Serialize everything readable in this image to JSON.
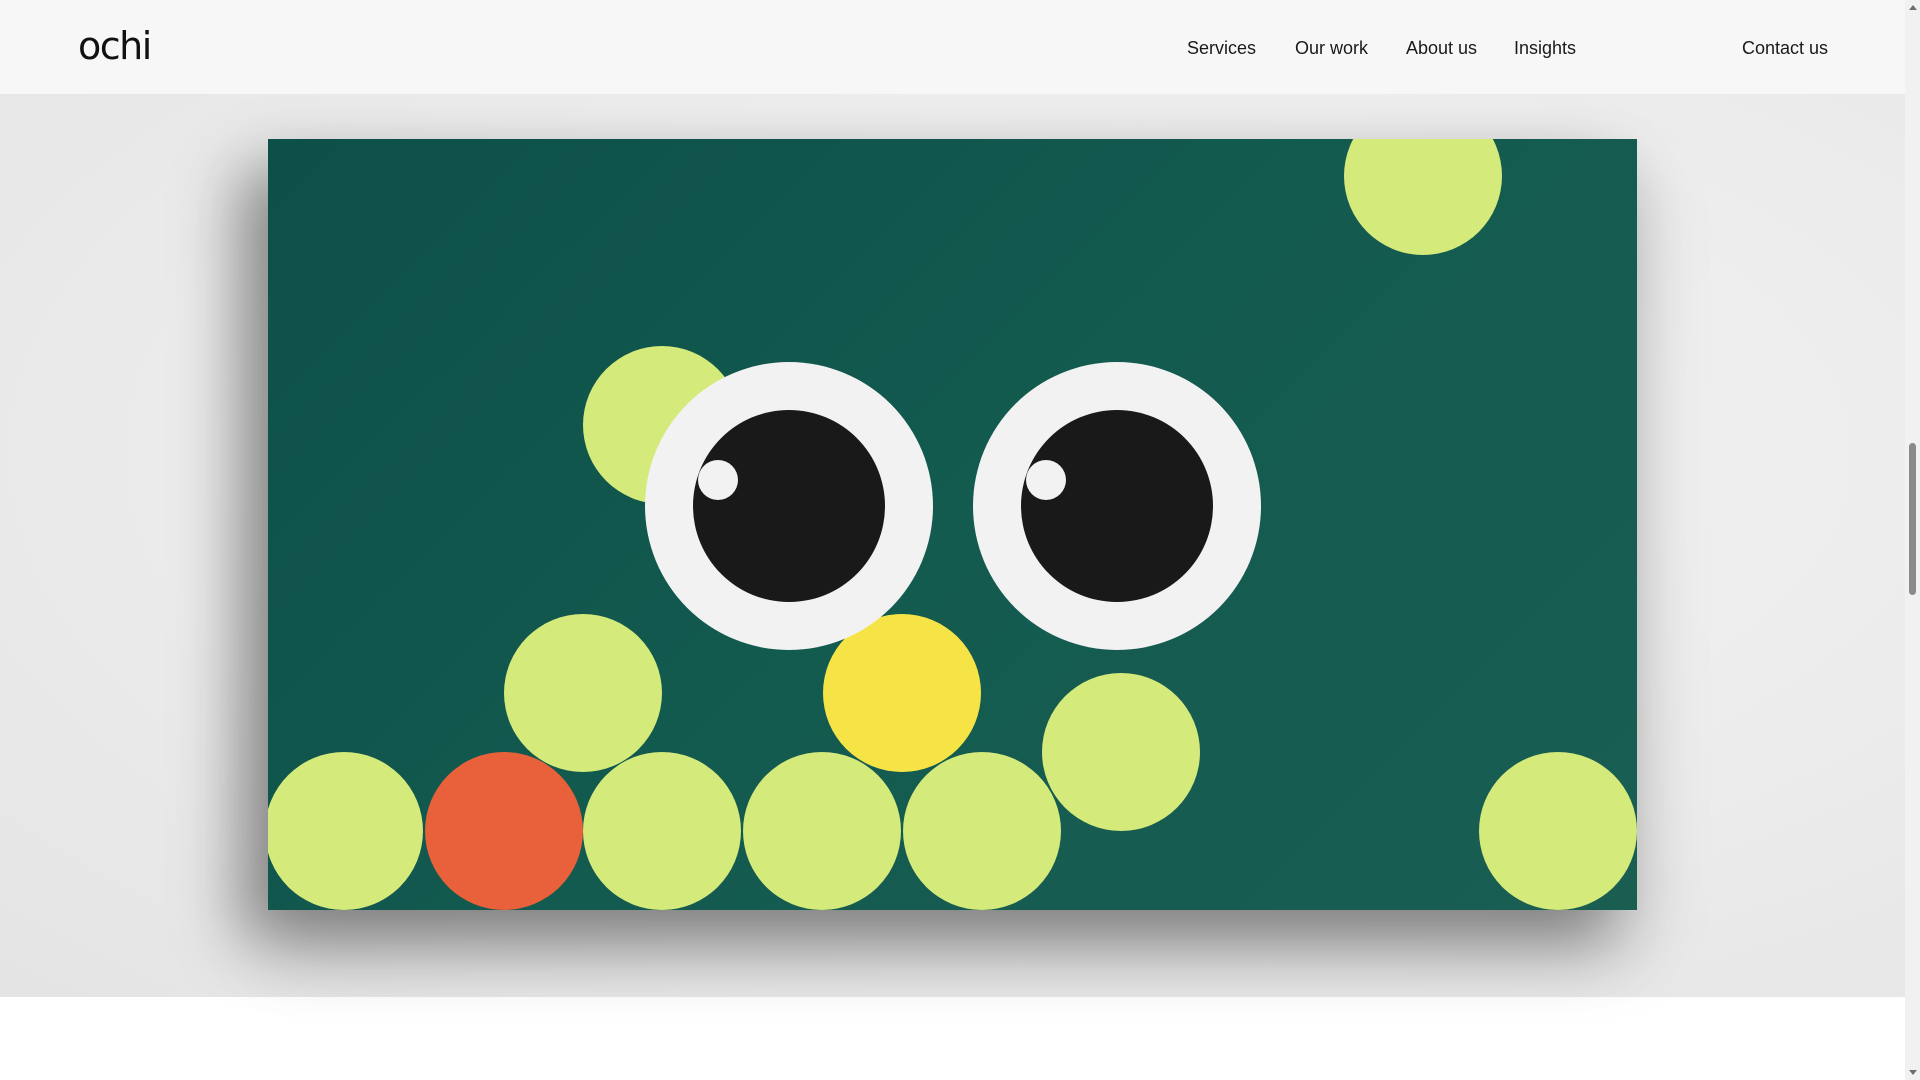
{
  "header": {
    "logo_text": "ochi",
    "nav": [
      "Services",
      "Our work",
      "About us",
      "Insights"
    ],
    "contact_label": "Contact us"
  },
  "artwork": {
    "background_color": "#0e5148",
    "colors": {
      "lime": "#d4ea7a",
      "orange": "#e8613a",
      "yellow": "#f6e447",
      "eye_white": "#f2f2f2",
      "pupil": "#19191a"
    }
  },
  "scrollbar": {
    "position_fraction": 0.47
  }
}
